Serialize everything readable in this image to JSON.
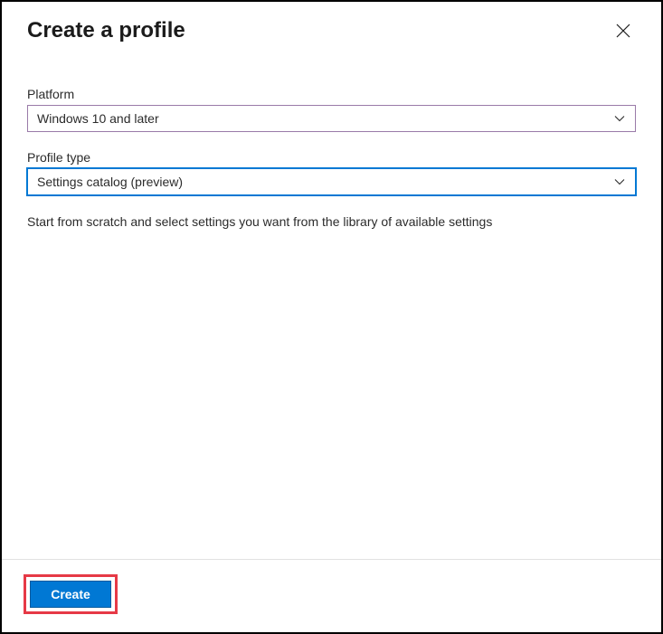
{
  "header": {
    "title": "Create a profile"
  },
  "form": {
    "platform": {
      "label": "Platform",
      "value": "Windows 10 and later"
    },
    "profile_type": {
      "label": "Profile type",
      "value": "Settings catalog (preview)"
    },
    "description": "Start from scratch and select settings you want from the library of available settings"
  },
  "footer": {
    "create_label": "Create"
  }
}
